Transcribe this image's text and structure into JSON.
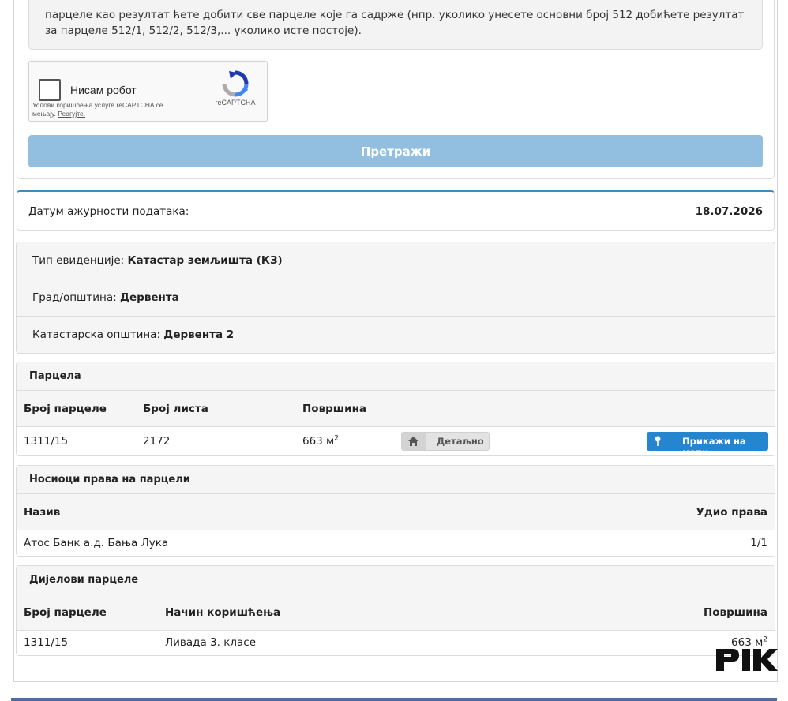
{
  "notice": {
    "text": "парцеле као резултат ћете добити све парцеле које га садрже (нпр. уколико унесете основни број 512 добићете резултат за парцеле 512/1, 512/2, 512/3,... уколико исте постоје)."
  },
  "captcha": {
    "label": "Нисам робот",
    "terms": "Услови коришћења услуге reCAPTCHA се мењају.",
    "terms_link": "Реагујте.",
    "brand": "reCAPTCHA"
  },
  "search": {
    "label": "Претражи"
  },
  "freshness": {
    "label": "Датум ажурности података:",
    "date": "18.07.2026"
  },
  "info": [
    {
      "label": "Тип евиденције:",
      "value": "Катастар земљишта (КЗ)"
    },
    {
      "label": "Град/општина:",
      "value": "Дервента"
    },
    {
      "label": "Катастарска општина:",
      "value": "Дервента 2"
    }
  ],
  "parcel": {
    "title": "Парцела",
    "columns": [
      "Број парцеле",
      "Број листа",
      "Површина"
    ],
    "row": {
      "number": "1311/15",
      "sheet": "2172",
      "area": "663 м",
      "unit_sup": "2"
    },
    "detail_button": "Детаљно",
    "map_button": "Прикажи на мапи"
  },
  "holders": {
    "title": "Носиоци права на парцели",
    "columns": [
      "Назив",
      "Удио права"
    ],
    "row": {
      "name": "Атос Банк а.д. Бања Лука",
      "share": "1/1"
    }
  },
  "parts": {
    "title": "Дијелови парцеле",
    "columns": [
      "Број парцеле",
      "Начин коришћења",
      "Површина"
    ],
    "row": {
      "number": "1311/15",
      "use": "Ливада 3. класе",
      "area": "663 м",
      "unit_sup": "2"
    }
  },
  "watermark": {
    "text": "PIK"
  },
  "colors": {
    "primary": "#2685cf",
    "search_button": "#92bfe0",
    "accent_border": "#3c8dbc"
  }
}
